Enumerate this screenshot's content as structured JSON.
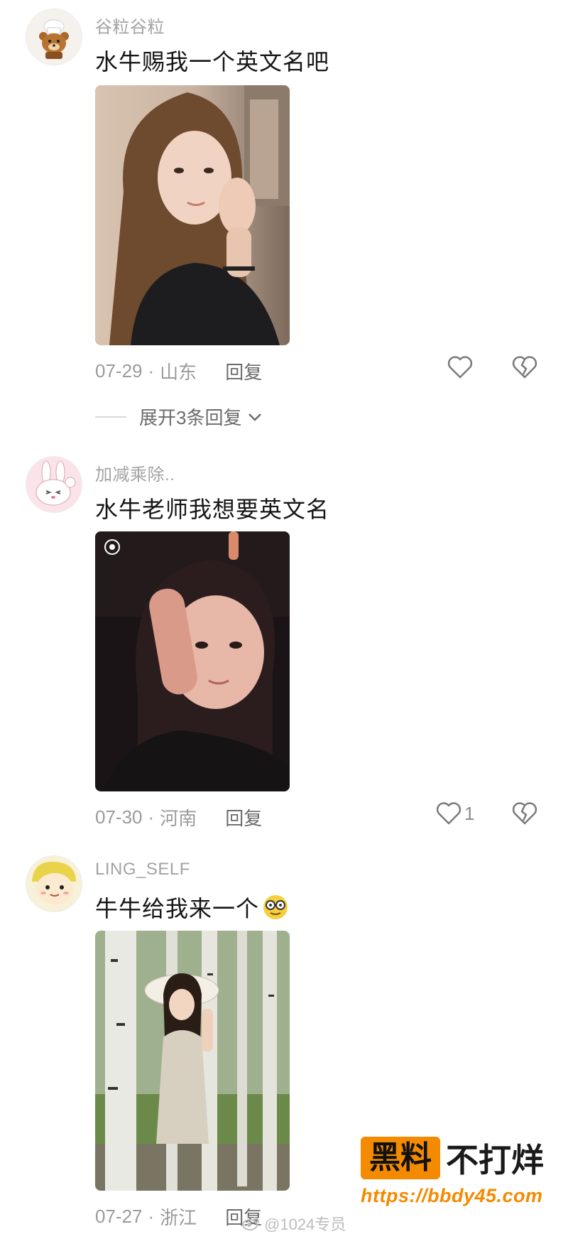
{
  "comments": [
    {
      "username": "谷粒谷粒",
      "text": "水牛赐我一个英文名吧",
      "date": "07-29",
      "location": "山东",
      "reply_label": "回复",
      "likes": "",
      "avatar_icon": "bear-chef-avatar",
      "photo_desc": "girl-selfie"
    },
    {
      "username": "加减乘除..",
      "text": "水牛老师我想要英文名",
      "date": "07-30",
      "location": "河南",
      "reply_label": "回复",
      "likes": "1",
      "avatar_icon": "bunny-avatar",
      "photo_desc": "girl-night-selfie"
    },
    {
      "username": "LING_SELF",
      "text": "牛牛给我来一个",
      "date": "07-27",
      "location": "浙江",
      "reply_label": "回复",
      "likes": "",
      "avatar_icon": "cartoon-face-avatar",
      "photo_desc": "girl-in-birch-forest"
    }
  ],
  "expand_replies": "展开3条回复",
  "separator": "·",
  "badge": {
    "hot": "黑料",
    "rest": "不打烊",
    "url": "https://bbdy45.com"
  },
  "watermark": "@1024专员",
  "colors": {
    "accent": "#f48a00",
    "muted_text": "#a3a3a3",
    "body_text": "#161616"
  }
}
